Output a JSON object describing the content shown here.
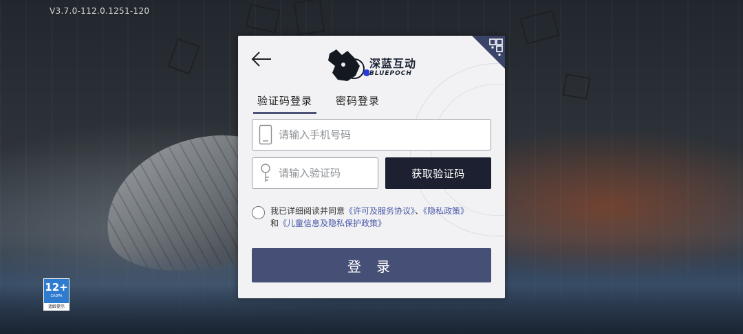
{
  "app": {
    "version": "V3.7.0-112.0.1251-120"
  },
  "age_rating": {
    "age": "12+",
    "org": "CADPA",
    "tip": "适龄提示"
  },
  "login_panel": {
    "logo": {
      "name_cn": "深蓝互动",
      "name_en": "BLUEPOCH"
    },
    "tabs": [
      {
        "label": "验证码登录",
        "active": true
      },
      {
        "label": "密码登录",
        "active": false
      }
    ],
    "phone_input": {
      "placeholder": "请输入手机号码",
      "value": ""
    },
    "code_input": {
      "placeholder": "请输入验证码",
      "value": ""
    },
    "get_code_label": "获取验证码",
    "agreement": {
      "prefix": "我已详细阅读并同意",
      "link_terms": "《许可及服务协议》",
      "separator": "、",
      "link_privacy": "《隐私政策》",
      "and": "和",
      "link_children": "《儿童信息及隐私保护政策》",
      "checked": false
    },
    "login_label": "登 录"
  },
  "colors": {
    "primary_button": "#464f75",
    "dark_button": "#1d2030",
    "link": "#4a5aa8",
    "panel_bg": "#f2f2f4"
  }
}
